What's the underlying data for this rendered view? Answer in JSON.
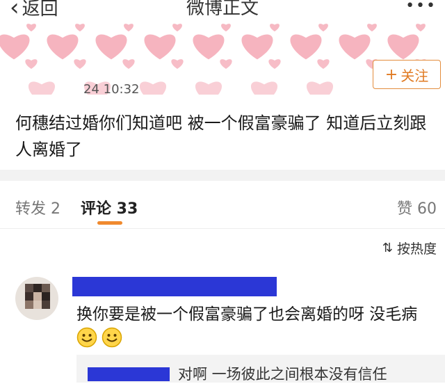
{
  "nav": {
    "back_label": "返回",
    "title": "微博正文",
    "more": "•••"
  },
  "post": {
    "time": "24 10:32",
    "follow_label": "关注",
    "text": "何穗结过婚你们知道吧  被一个假富豪骗了  知道后立刻跟人离婚了"
  },
  "tabs": {
    "repost": "转发 2",
    "comments": "评论 33",
    "likes": "赞 60"
  },
  "sort": {
    "label": "按热度",
    "icon": "sort-icon"
  },
  "comment": {
    "text": "换你要是被一个假富豪骗了也会离婚的呀 没毛病",
    "emoji_icon": "smile-emoji-icon",
    "reply_text": "对啊 一场彼此之间根本没有信任"
  },
  "colors": {
    "accent": "#f08a2e",
    "follow": "#e07a22",
    "redaction": "#2b37d6",
    "heart": "#f4a7b4"
  }
}
